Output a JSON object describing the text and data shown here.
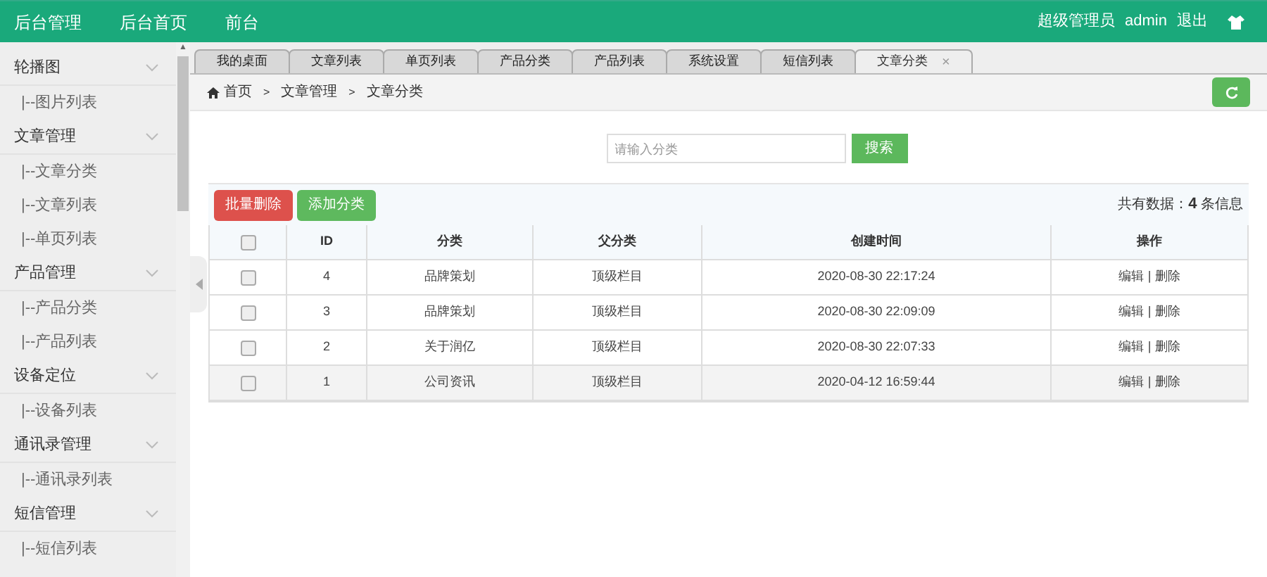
{
  "header": {
    "nav": [
      {
        "label": "后台管理"
      },
      {
        "label": "后台首页"
      },
      {
        "label": "前台"
      }
    ],
    "role": "超级管理员",
    "user": "admin",
    "logout": "退出"
  },
  "sidebar": {
    "groups": [
      {
        "label": "轮播图",
        "expanded": true,
        "children": [
          {
            "label": "|--图片列表"
          }
        ]
      },
      {
        "label": "文章管理",
        "expanded": true,
        "children": [
          {
            "label": "|--文章分类"
          },
          {
            "label": "|--文章列表"
          },
          {
            "label": "|--单页列表"
          }
        ]
      },
      {
        "label": "产品管理",
        "expanded": true,
        "children": [
          {
            "label": "|--产品分类"
          },
          {
            "label": "|--产品列表"
          }
        ]
      },
      {
        "label": "设备定位",
        "expanded": true,
        "children": [
          {
            "label": "|--设备列表"
          }
        ]
      },
      {
        "label": "通讯录管理",
        "expanded": true,
        "children": [
          {
            "label": "|--通讯录列表"
          }
        ]
      },
      {
        "label": "短信管理",
        "expanded": true,
        "children": [
          {
            "label": "|--短信列表"
          }
        ]
      }
    ]
  },
  "tabs": [
    {
      "label": "我的桌面",
      "selected": false,
      "closable": false
    },
    {
      "label": "文章列表",
      "selected": false,
      "closable": false
    },
    {
      "label": "单页列表",
      "selected": false,
      "closable": false
    },
    {
      "label": "产品分类",
      "selected": false,
      "closable": false
    },
    {
      "label": "产品列表",
      "selected": false,
      "closable": false
    },
    {
      "label": "系统设置",
      "selected": false,
      "closable": false
    },
    {
      "label": "短信列表",
      "selected": false,
      "closable": false
    },
    {
      "label": "文章分类",
      "selected": true,
      "closable": true
    }
  ],
  "breadcrumb": [
    "首页",
    "文章管理",
    "文章分类"
  ],
  "breadcrumb_separator": ">",
  "scroll_up": "▲",
  "close_glyph": "×",
  "link_separator": "|",
  "search": {
    "placeholder": "请输入分类",
    "button": "搜索"
  },
  "toolbar": {
    "batch_delete": "批量删除",
    "add": "添加分类",
    "total_prefix": "共有数据：",
    "total_count": "4",
    "total_suffix": " 条信息"
  },
  "table": {
    "all_checked": false,
    "columns": [
      "ID",
      "分类",
      "父分类",
      "创建时间",
      "操作"
    ],
    "rows": [
      {
        "checked": false,
        "id": "4",
        "category": "品牌策划",
        "parent": "顶级栏目",
        "created": "2020-08-30 22:17:24",
        "edit": "编辑",
        "delete": "删除",
        "highlighted": false
      },
      {
        "checked": false,
        "id": "3",
        "category": "品牌策划",
        "parent": "顶级栏目",
        "created": "2020-08-30 22:09:09",
        "edit": "编辑",
        "delete": "删除",
        "highlighted": false
      },
      {
        "checked": false,
        "id": "2",
        "category": "关于润亿",
        "parent": "顶级栏目",
        "created": "2020-08-30 22:07:33",
        "edit": "编辑",
        "delete": "删除",
        "highlighted": false
      },
      {
        "checked": false,
        "id": "1",
        "category": "公司资讯",
        "parent": "顶级栏目",
        "created": "2020-04-12 16:59:44",
        "edit": "编辑",
        "delete": "删除",
        "highlighted": true
      }
    ]
  }
}
